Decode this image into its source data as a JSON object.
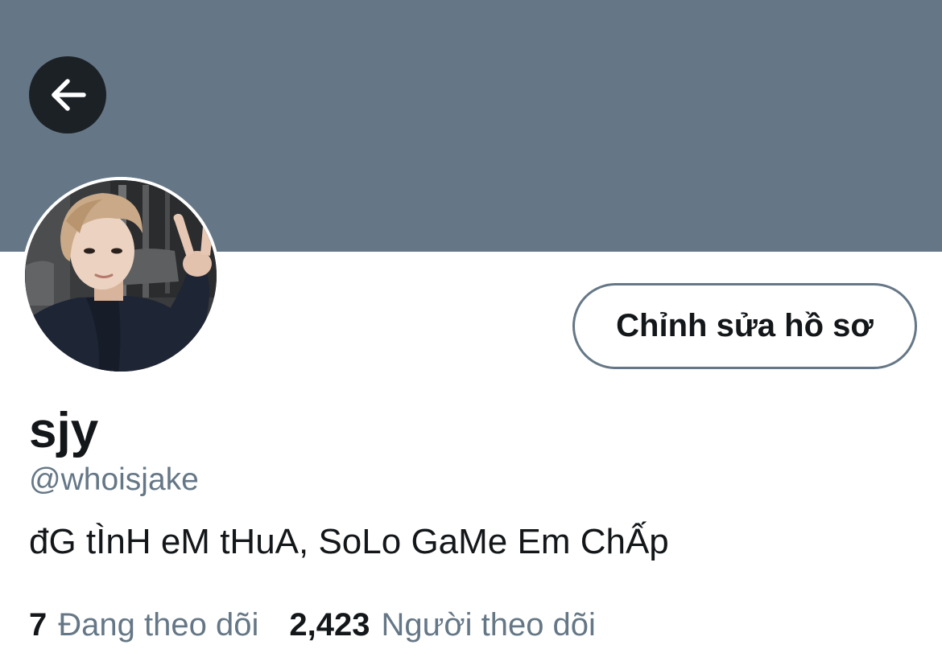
{
  "header": {
    "back_icon": "arrow-left-icon",
    "banner_color": "#657786"
  },
  "profile": {
    "avatar_icon": "profile-photo",
    "display_name": "sjy",
    "handle": "@whoisjake",
    "bio": "đG tÌnH eM tHuA, SoLo GaMe Em ChẤp",
    "edit_button_label": "Chỉnh sửa hồ sơ"
  },
  "stats": {
    "following_count": "7",
    "following_label": "Đang theo dõi",
    "followers_count": "2,423",
    "followers_label": "Người theo dõi"
  },
  "colors": {
    "text_primary": "#14171a",
    "text_secondary": "#657786",
    "back_button_bg": "#1c2126"
  }
}
